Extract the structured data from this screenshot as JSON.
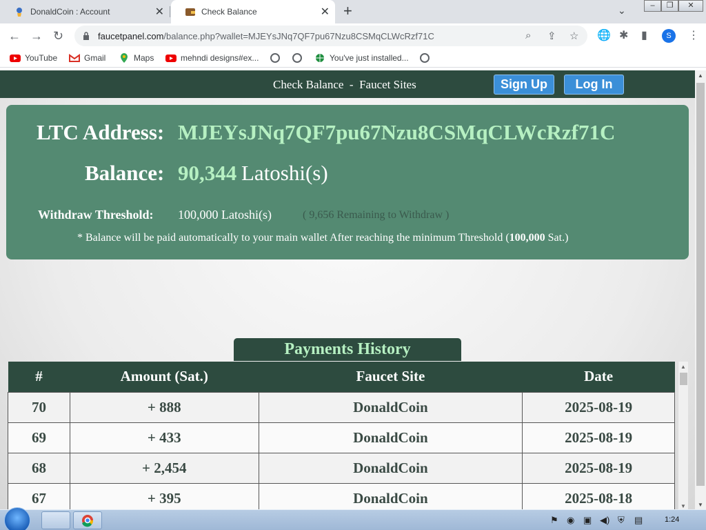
{
  "browser": {
    "tabs": [
      {
        "title": "DonaldCoin : Account",
        "active": false
      },
      {
        "title": "Check Balance",
        "active": true
      }
    ],
    "url_domain": "faucetpanel.com",
    "url_path": "/balance.php?wallet=MJEYsJNq7QF7pu67Nzu8CSMqCLWcRzf71C",
    "profile_initial": "S",
    "bookmarks": [
      {
        "label": "YouTube",
        "icon": "youtube-icon"
      },
      {
        "label": "Gmail",
        "icon": "gmail-icon"
      },
      {
        "label": "Maps",
        "icon": "maps-icon"
      },
      {
        "label": "mehndi designs#ex...",
        "icon": "youtube-icon"
      },
      {
        "label": "",
        "icon": "globe-icon"
      },
      {
        "label": "",
        "icon": "globe-icon"
      },
      {
        "label": "You've just installed...",
        "icon": "globe-icon"
      },
      {
        "label": "",
        "icon": "globe-icon"
      }
    ]
  },
  "header": {
    "title": "Check Balance  -  Faucet Sites",
    "signup_label": "Sign Up",
    "login_label": "Log In"
  },
  "account": {
    "address_label": "LTC Address:",
    "address": "MJEYsJNq7QF7pu67Nzu8CSMqCLWcRzf71C",
    "balance_label": "Balance:",
    "balance_value": "90,344",
    "balance_unit": "Latoshi(s)",
    "threshold_label": "Withdraw Threshold:",
    "threshold_value": "100,000 Latoshi(s)",
    "remaining": "( 9,656 Remaining to Withdraw )",
    "note_pre": "* Balance will be paid automatically to your main wallet After reaching the minimum Threshold (",
    "note_bold": "100,000",
    "note_post": " Sat.)"
  },
  "payments": {
    "title": "Payments History",
    "headers": [
      "#",
      "Amount (Sat.)",
      "Faucet Site",
      "Date"
    ],
    "rows": [
      {
        "id": "70",
        "amount": "+ 888",
        "site": "DonaldCoin",
        "date": "2025-08-19"
      },
      {
        "id": "69",
        "amount": "+ 433",
        "site": "DonaldCoin",
        "date": "2025-08-19"
      },
      {
        "id": "68",
        "amount": "+ 2,454",
        "site": "DonaldCoin",
        "date": "2025-08-19"
      },
      {
        "id": "67",
        "amount": "+ 395",
        "site": "DonaldCoin",
        "date": "2025-08-18"
      }
    ]
  },
  "taskbar": {
    "clock": "1:24"
  },
  "colors": {
    "nav_bg": "#2d4b3f",
    "card_bg": "#548a72",
    "accent_green": "#b6f0c2",
    "button_blue": "#3b8fd8"
  }
}
